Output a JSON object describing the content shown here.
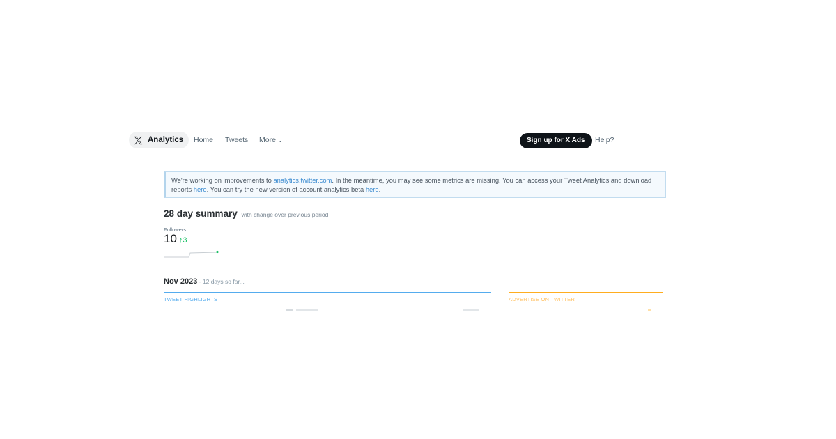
{
  "nav": {
    "brand": "Analytics",
    "links": {
      "home": "Home",
      "tweets": "Tweets",
      "more": "More"
    },
    "more_chevron": "⌄",
    "ads_button": "Sign up for X Ads",
    "help": "Help?"
  },
  "notice": {
    "text1": "We're working on improvements to ",
    "link1": "analytics.twitter.com",
    "text2": ". In the meantime, you may see some metrics are missing. You can access your Tweet Analytics and download reports ",
    "link2": "here",
    "text3": ". You can try the new version of account analytics beta ",
    "link3": "here",
    "text4": "."
  },
  "summary": {
    "title": "28 day summary",
    "subtitle": "with change over previous period",
    "followers_label": "Followers",
    "followers_value": "10",
    "followers_change_arrow": "↑",
    "followers_change": "3"
  },
  "month": {
    "title": "Nov 2023",
    "sep": " - ",
    "subtitle": "12 days so far..."
  },
  "sections": {
    "highlights": "TWEET HIGHLIGHTS",
    "advertise": "ADVERTISE ON TWITTER"
  },
  "colors": {
    "highlights_accent": "#55acee",
    "advertise_accent": "#ffad1f",
    "positive": "#17bf63",
    "ads_button_bg": "#0f1419"
  },
  "icons": {
    "logo": "x-logo-icon"
  }
}
